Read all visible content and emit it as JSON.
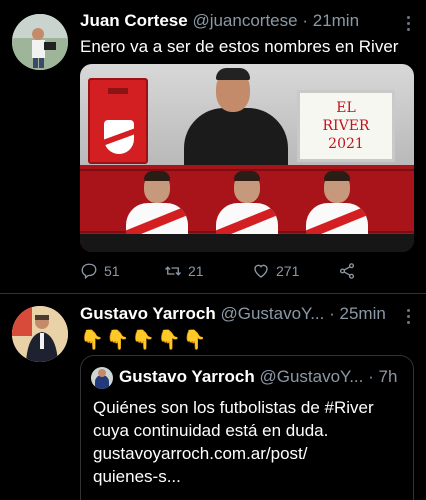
{
  "tweets": [
    {
      "name": "Juan Cortese",
      "handle": "@juancortese",
      "sep": "·",
      "time": "21min",
      "text": "Enero va a ser de estos nombres en River",
      "media": {
        "board_lines": [
          "EL",
          "RIVER",
          "2021"
        ]
      },
      "actions": {
        "replies": "51",
        "retweets": "21",
        "likes": "271"
      }
    },
    {
      "name": "Gustavo Yarroch",
      "handle": "@GustavoY...",
      "sep": "·",
      "time": "25min",
      "text": "👇👇👇👇👇",
      "quote": {
        "name": "Gustavo Yarroch",
        "handle": "@GustavoY...",
        "sep": "·",
        "time": "7h",
        "lines": [
          "Quiénes son los futbolistas de #River",
          "cuya continuidad está en duda.",
          " gustavoyarroch.com.ar/post/",
          "quienes-s..."
        ]
      }
    }
  ],
  "colors": {
    "background": "#000000",
    "muted": "#8b98a5",
    "divider": "#2f3336",
    "river_red": "#d31f22"
  }
}
